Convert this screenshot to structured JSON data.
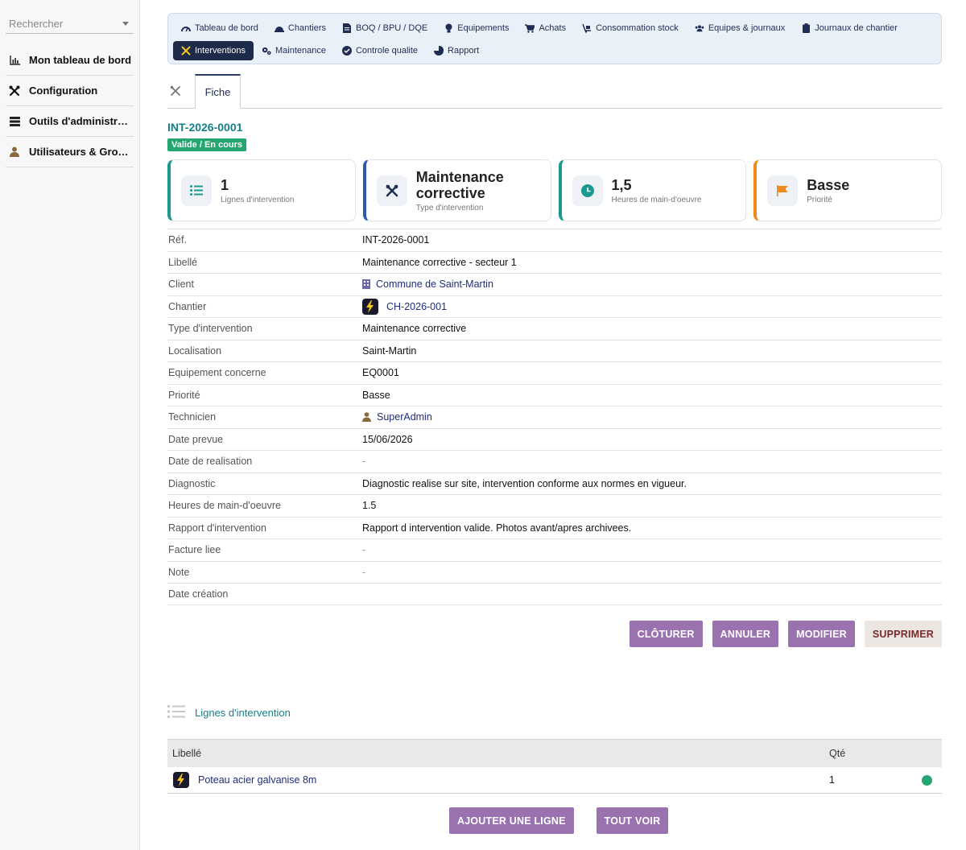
{
  "sidebar": {
    "search_placeholder": "Rechercher",
    "items": [
      {
        "label": "Mon tableau de bord",
        "icon": "chart-icon"
      },
      {
        "label": "Configuration",
        "icon": "tools-icon"
      },
      {
        "label": "Outils d'administrat…",
        "icon": "server-icon"
      },
      {
        "label": "Utilisateurs & Grou…",
        "icon": "user-icon"
      }
    ]
  },
  "topnav": {
    "row1": [
      {
        "label": "Tableau de bord",
        "icon": "dashboard-icon"
      },
      {
        "label": "Chantiers",
        "icon": "helmet-icon"
      },
      {
        "label": "BOQ / BPU / DQE",
        "icon": "document-icon"
      },
      {
        "label": "Equipements",
        "icon": "lightbulb-icon"
      },
      {
        "label": "Achats",
        "icon": "cart-icon"
      },
      {
        "label": "Consommation stock",
        "icon": "dolly-icon"
      },
      {
        "label": "Equipes & journaux",
        "icon": "team-icon"
      },
      {
        "label": "Journaux de chantier",
        "icon": "clipboard-icon"
      }
    ],
    "row2": [
      {
        "label": "Interventions",
        "icon": "tools-icon",
        "active": true
      },
      {
        "label": "Maintenance",
        "icon": "gears-icon"
      },
      {
        "label": "Controle qualite",
        "icon": "check-circle-icon"
      },
      {
        "label": "Rapport",
        "icon": "pie-icon"
      }
    ]
  },
  "tabs": {
    "fiche": "Fiche"
  },
  "record": {
    "ref": "INT-2026-0001",
    "status": "Valide / En cours"
  },
  "cards": [
    {
      "value": "1",
      "label": "Lignes d'intervention",
      "icon": "list-icon",
      "accent": "#1a9a8f"
    },
    {
      "value": "Maintenance corrective",
      "label": "Type d'intervention",
      "icon": "tools-icon",
      "accent": "#2a5caa"
    },
    {
      "value": "1,5",
      "label": "Heures de main-d'oeuvre",
      "icon": "clock-icon",
      "accent": "#1a9a8f"
    },
    {
      "value": "Basse",
      "label": "Priorité",
      "icon": "flag-icon",
      "accent": "#f08a1a"
    }
  ],
  "fields": [
    {
      "key": "Réf.",
      "value": "INT-2026-0001"
    },
    {
      "key": "Libellé",
      "value": "Maintenance corrective - secteur 1"
    },
    {
      "key": "Client",
      "value": "Commune de Saint-Martin"
    },
    {
      "key": "Chantier",
      "value": "CH-2026-001"
    },
    {
      "key": "Type d'intervention",
      "value": "Maintenance corrective"
    },
    {
      "key": "Localisation",
      "value": "Saint-Martin"
    },
    {
      "key": "Equipement concerne",
      "value": "EQ0001"
    },
    {
      "key": "Priorité",
      "value": "Basse"
    },
    {
      "key": "Technicien",
      "value": "SuperAdmin"
    },
    {
      "key": "Date prevue",
      "value": "15/06/2026"
    },
    {
      "key": "Date de realisation",
      "value": "-"
    },
    {
      "key": "Diagnostic",
      "value": "Diagnostic realise sur site, intervention conforme aux normes en vigueur."
    },
    {
      "key": "Heures de main-d'oeuvre",
      "value": "1.5"
    },
    {
      "key": "Rapport d'intervention",
      "value": "Rapport d intervention valide. Photos avant/apres archivees."
    },
    {
      "key": "Facture liee",
      "value": "-"
    },
    {
      "key": "Note",
      "value": "-"
    },
    {
      "key": "Date création",
      "value": ""
    }
  ],
  "actions": {
    "close": "CLÔTURER",
    "cancel": "ANNULER",
    "edit": "MODIFIER",
    "delete": "SUPPRIMER"
  },
  "lines": {
    "title": "Lignes d'intervention",
    "columns": {
      "label": "Libellé",
      "qty": "Qté"
    },
    "rows": [
      {
        "label": "Poteau acier galvanise 8m",
        "qty": "1"
      }
    ],
    "add": "AJOUTER UNE LIGNE",
    "see_all": "TOUT VOIR"
  },
  "colors": {
    "accent_teal": "#157f88",
    "status_green": "#25a570",
    "button_purple": "#9a72b0",
    "nav_active": "#1d2a4a"
  }
}
